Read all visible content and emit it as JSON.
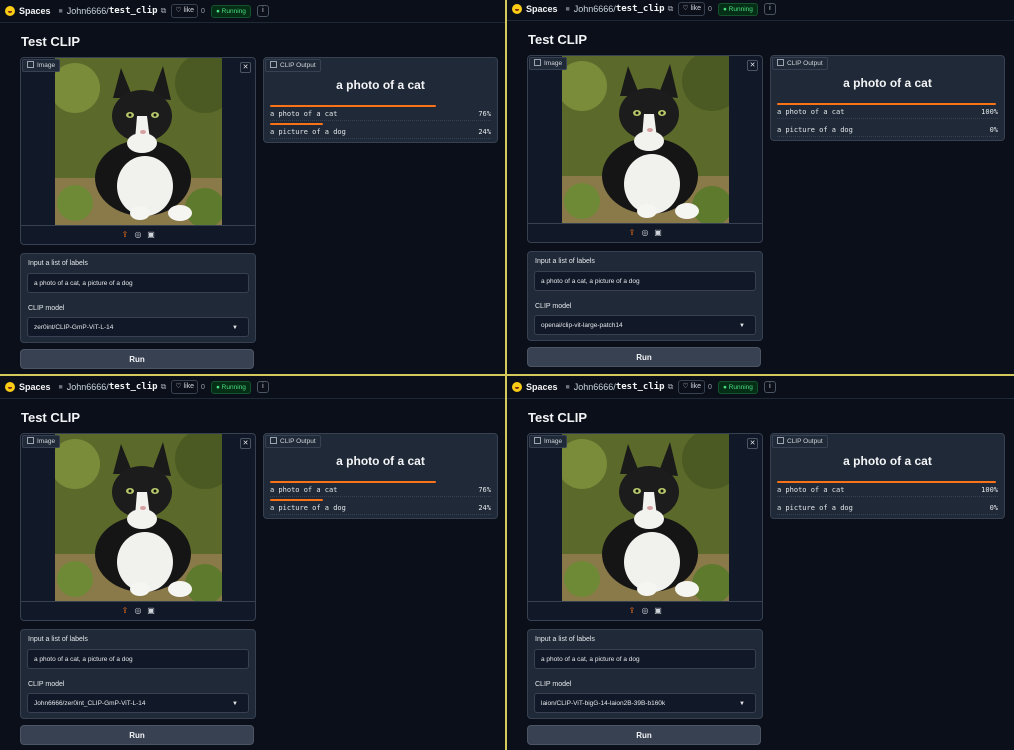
{
  "spaces_label": "Spaces",
  "owner": "John6666/",
  "repo": "test_clip",
  "like_label": "♡ like",
  "like_count": "0",
  "status": "● Running",
  "info": "i",
  "app_title": "Test CLIP",
  "image_tag": "Image",
  "output_tag": "CLIP Output",
  "labels_field_label": "Input a list of labels",
  "model_field_label": "CLIP model",
  "labels_value": "a photo of a cat, a picture of a dog",
  "run_label": "Run",
  "accent_color": "#f97316",
  "panels": [
    {
      "top_label": "a photo of a cat",
      "results": [
        {
          "label": "a photo of a cat",
          "percent": "76%",
          "fraction": 0.76
        },
        {
          "label": "a picture of a dog",
          "percent": "24%",
          "fraction": 0.24
        }
      ],
      "model": "zer0int/CLIP-GmP-ViT-L-14"
    },
    {
      "top_label": "a photo of a cat",
      "results": [
        {
          "label": "a photo of a cat",
          "percent": "100%",
          "fraction": 1.0
        },
        {
          "label": "a picture of a dog",
          "percent": "0%",
          "fraction": 0.0
        }
      ],
      "model": "openai/clip-vit-large-patch14"
    },
    {
      "top_label": "a photo of a cat",
      "results": [
        {
          "label": "a photo of a cat",
          "percent": "76%",
          "fraction": 0.76
        },
        {
          "label": "a picture of a dog",
          "percent": "24%",
          "fraction": 0.24
        }
      ],
      "model": "John6666/zer0int_CLIP-GmP-ViT-L-14"
    },
    {
      "top_label": "a photo of a cat",
      "results": [
        {
          "label": "a photo of a cat",
          "percent": "100%",
          "fraction": 1.0
        },
        {
          "label": "a picture of a dog",
          "percent": "0%",
          "fraction": 0.0
        }
      ],
      "model": "laion/CLIP-ViT-bigG-14-laion2B-39B-b160k"
    }
  ]
}
